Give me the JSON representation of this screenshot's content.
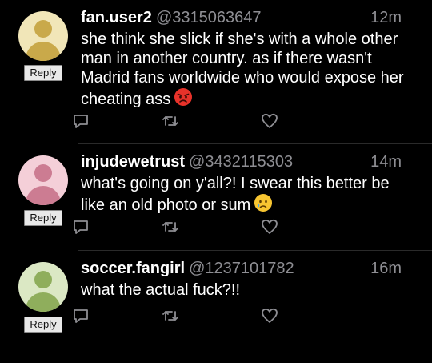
{
  "reply_button_label": "Reply",
  "colors": {
    "background": "#000000",
    "text_primary": "#ffffff",
    "text_secondary": "#8e8e93",
    "avatar_user1": "#f1e6b8",
    "avatar_user1_fg": "#c9a94a",
    "avatar_user2": "#f4cfd8",
    "avatar_user2_fg": "#cc7c92",
    "avatar_user3": "#dbe8c4",
    "avatar_user3_fg": "#8fae5c"
  },
  "tweets": [
    {
      "username": "fan.user2",
      "handle": "@3315063647",
      "time": "12m",
      "text": "she think she slick if she's with a whole other man in another country. as if there wasn't Madrid fans worldwide who would expose her cheating ass",
      "emoji": "angry-face-emoji"
    },
    {
      "username": "injudewetrust",
      "handle": "@3432115303",
      "time": "14m",
      "text": "what's going on y'all?! I swear this better be like an old photo or sum",
      "emoji": "crying-face-emoji"
    },
    {
      "username": "soccer.fangirl",
      "handle": "@1237101782",
      "time": "16m",
      "text": "what the actual fuck?!!"
    }
  ]
}
